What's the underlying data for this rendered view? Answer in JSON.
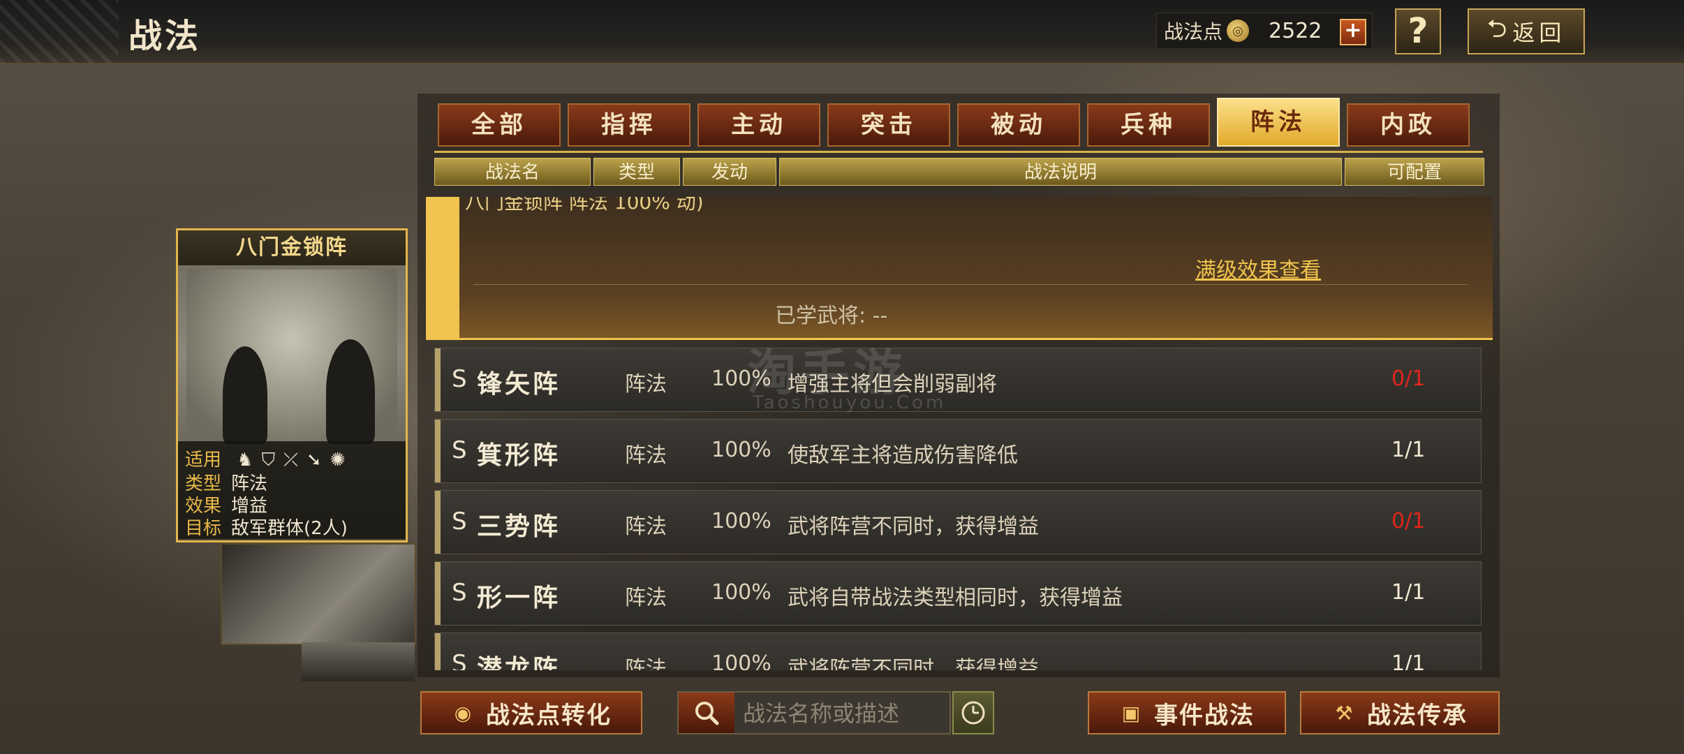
{
  "header": {
    "title": "战法",
    "points_label": "战法点",
    "points_value": "2522",
    "help_label": "?",
    "back_label": "返回"
  },
  "tabs": [
    {
      "label": "全部",
      "active": false
    },
    {
      "label": "指挥",
      "active": false
    },
    {
      "label": "主动",
      "active": false
    },
    {
      "label": "突击",
      "active": false
    },
    {
      "label": "被动",
      "active": false
    },
    {
      "label": "兵种",
      "active": false
    },
    {
      "label": "阵法",
      "active": true
    },
    {
      "label": "内政",
      "active": false
    }
  ],
  "columns": {
    "name": "战法名",
    "type": "类型",
    "trigger": "发动",
    "desc": "战法说明",
    "config": "可配置"
  },
  "card": {
    "name": "八门金锁阵",
    "rows": [
      {
        "k": "适用",
        "v": ""
      },
      {
        "k": "类型",
        "v": "阵法"
      },
      {
        "k": "效果",
        "v": "增益"
      },
      {
        "k": "目标",
        "v": "敌军群体(2人)"
      }
    ]
  },
  "expanded": {
    "ghost_text": "八门金锁阵    阵法    100%       动)",
    "link": "满级效果查看",
    "learned": "已学武将: --"
  },
  "rows": [
    {
      "grade": "S",
      "name": "锋矢阵",
      "type": "阵法",
      "pct": "100%",
      "desc": "增强主将但会削弱副将",
      "count": "0/1",
      "red": true
    },
    {
      "grade": "S",
      "name": "箕形阵",
      "type": "阵法",
      "pct": "100%",
      "desc": "使敌军主将造成伤害降低",
      "count": "1/1",
      "red": false
    },
    {
      "grade": "S",
      "name": "三势阵",
      "type": "阵法",
      "pct": "100%",
      "desc": "武将阵营不同时，获得增益",
      "count": "0/1",
      "red": true
    },
    {
      "grade": "S",
      "name": "形一阵",
      "type": "阵法",
      "pct": "100%",
      "desc": "武将自带战法类型相同时，获得增益",
      "count": "1/1",
      "red": false
    },
    {
      "grade": "S",
      "name": "潜龙阵",
      "type": "阵法",
      "pct": "100%",
      "desc": "武将阵营不同时，获得增益",
      "count": "1/1",
      "red": false
    }
  ],
  "watermark": {
    "cn": "淘手游",
    "en": "Taoshouyou.Com"
  },
  "bottom": {
    "convert_label": "战法点转化",
    "search_placeholder": "战法名称或描述",
    "event_label": "事件战法",
    "inherit_label": "战法传承"
  },
  "colors": {
    "accent": "#f0c44e",
    "tab_active": "#e1aa2a",
    "red_count": "#e0261c"
  }
}
